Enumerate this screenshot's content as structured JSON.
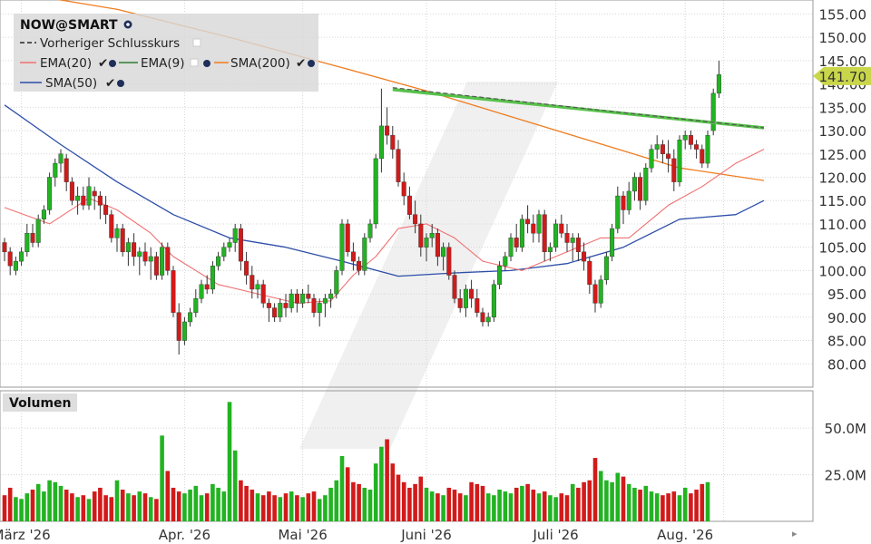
{
  "chart_data": {
    "type": "candlestick",
    "title": "NOW@SMART",
    "legend": {
      "placement": "top-left",
      "items": [
        {
          "label": "Vorheriger Schlusskurs",
          "color": "#555555",
          "style": "dashed"
        },
        {
          "label": "EMA(20)",
          "color": "#f07070"
        },
        {
          "label": "EMA(9)",
          "color": "#2e7d32"
        },
        {
          "label": "SMA(200)",
          "color": "#f07c1e"
        },
        {
          "label": "SMA(50)",
          "color": "#2d4ea8"
        }
      ]
    },
    "price_axis": {
      "ylim": [
        75,
        158
      ],
      "ticks": [
        80,
        85,
        90,
        95,
        100,
        105,
        110,
        115,
        120,
        125,
        130,
        135,
        140,
        145,
        150,
        155
      ],
      "tick_labels": [
        "80.00",
        "85.00",
        "90.00",
        "95.00",
        "100.00",
        "105.00",
        "110.00",
        "115.00",
        "120.00",
        "125.00",
        "130.00",
        "135.00",
        "140.00",
        "145.00",
        "150.00",
        "155.00"
      ],
      "last_price_label": "141.70",
      "last_price": 141.7
    },
    "volume_panel": {
      "title": "Volumen",
      "ylim": [
        0,
        70
      ],
      "ticks": [
        25,
        50
      ],
      "tick_labels": [
        "25.0M",
        "50.0M"
      ]
    },
    "date_labels": [
      "März '26",
      "Apr. '26",
      "Mai '26",
      "Juni '26",
      "Juli '26",
      "Aug. '26"
    ],
    "date_label_index": [
      3,
      32,
      53,
      75,
      98,
      121
    ],
    "candles": [
      [
        106,
        107,
        102,
        104
      ],
      [
        104,
        105,
        99,
        101
      ],
      [
        100,
        103,
        99,
        102
      ],
      [
        102,
        105,
        101,
        104
      ],
      [
        104,
        110,
        103,
        108
      ],
      [
        108,
        110,
        105,
        106
      ],
      [
        106,
        112,
        105,
        111
      ],
      [
        111,
        114,
        110,
        113
      ],
      [
        113,
        121,
        112,
        120
      ],
      [
        120,
        124,
        118,
        123
      ],
      [
        123,
        126,
        121,
        125
      ],
      [
        124,
        125,
        117,
        119
      ],
      [
        119,
        120,
        114,
        115
      ],
      [
        115,
        118,
        112,
        116
      ],
      [
        116,
        118,
        113,
        114
      ],
      [
        114,
        120,
        113,
        118
      ],
      [
        117,
        118,
        113,
        116
      ],
      [
        116,
        117,
        111,
        114
      ],
      [
        114,
        116,
        110,
        112
      ],
      [
        112,
        113,
        106,
        107
      ],
      [
        107,
        110,
        104,
        109
      ],
      [
        109,
        110,
        103,
        104
      ],
      [
        104,
        107,
        101,
        106
      ],
      [
        106,
        108,
        101,
        103
      ],
      [
        103,
        105,
        99,
        104
      ],
      [
        104,
        106,
        101,
        102
      ],
      [
        102,
        105,
        98,
        103
      ],
      [
        103,
        104,
        98,
        99
      ],
      [
        99,
        106,
        98,
        105
      ],
      [
        105,
        106,
        99,
        100
      ],
      [
        100,
        101,
        90,
        91
      ],
      [
        91,
        93,
        82,
        85
      ],
      [
        85,
        90,
        84,
        89
      ],
      [
        89,
        92,
        88,
        91
      ],
      [
        91,
        96,
        90,
        94
      ],
      [
        94,
        98,
        93,
        97
      ],
      [
        97,
        99,
        95,
        96
      ],
      [
        96,
        102,
        95,
        101
      ],
      [
        101,
        104,
        100,
        103
      ],
      [
        103,
        106,
        102,
        105
      ],
      [
        105,
        107,
        104,
        106
      ],
      [
        106,
        110,
        104,
        109
      ],
      [
        109,
        110,
        100,
        102
      ],
      [
        102,
        104,
        97,
        99
      ],
      [
        99,
        101,
        94,
        96
      ],
      [
        96,
        98,
        94,
        97
      ],
      [
        97,
        98,
        92,
        93
      ],
      [
        93,
        94,
        89,
        92
      ],
      [
        92,
        93,
        89,
        90
      ],
      [
        90,
        94,
        89,
        93
      ],
      [
        93,
        95,
        90,
        92
      ],
      [
        92,
        96,
        91,
        95
      ],
      [
        95,
        96,
        91,
        93
      ],
      [
        93,
        96,
        92,
        95
      ],
      [
        95,
        97,
        93,
        94
      ],
      [
        94,
        95,
        90,
        91
      ],
      [
        91,
        94,
        88,
        93
      ],
      [
        93,
        95,
        90,
        94
      ],
      [
        94,
        96,
        92,
        95
      ],
      [
        95,
        101,
        94,
        100
      ],
      [
        100,
        111,
        99,
        110
      ],
      [
        110,
        111,
        103,
        104
      ],
      [
        104,
        106,
        100,
        102
      ],
      [
        102,
        103,
        99,
        100
      ],
      [
        100,
        108,
        99,
        107
      ],
      [
        107,
        111,
        106,
        110
      ],
      [
        110,
        125,
        109,
        124
      ],
      [
        124,
        139,
        121,
        131
      ],
      [
        131,
        135,
        127,
        129
      ],
      [
        129,
        131,
        124,
        126
      ],
      [
        126,
        128,
        118,
        119
      ],
      [
        119,
        121,
        114,
        116
      ],
      [
        116,
        118,
        111,
        112
      ],
      [
        112,
        115,
        108,
        110
      ],
      [
        110,
        112,
        103,
        105
      ],
      [
        105,
        108,
        102,
        107
      ],
      [
        107,
        110,
        105,
        108
      ],
      [
        108,
        109,
        101,
        103
      ],
      [
        103,
        106,
        100,
        105
      ],
      [
        105,
        106,
        98,
        99
      ],
      [
        99,
        100,
        93,
        94
      ],
      [
        94,
        96,
        91,
        92
      ],
      [
        92,
        97,
        90,
        96
      ],
      [
        96,
        98,
        92,
        94
      ],
      [
        94,
        96,
        90,
        91
      ],
      [
        91,
        92,
        88,
        89
      ],
      [
        89,
        91,
        88,
        90
      ],
      [
        90,
        98,
        89,
        97
      ],
      [
        97,
        102,
        96,
        101
      ],
      [
        101,
        104,
        100,
        103
      ],
      [
        103,
        108,
        102,
        107
      ],
      [
        107,
        110,
        104,
        105
      ],
      [
        105,
        112,
        104,
        111
      ],
      [
        111,
        114,
        108,
        110
      ],
      [
        110,
        112,
        106,
        108
      ],
      [
        108,
        113,
        106,
        112
      ],
      [
        112,
        113,
        102,
        104
      ],
      [
        104,
        106,
        102,
        105
      ],
      [
        105,
        111,
        104,
        110
      ],
      [
        110,
        112,
        107,
        108
      ],
      [
        108,
        110,
        104,
        106
      ],
      [
        106,
        108,
        102,
        107
      ],
      [
        107,
        108,
        102,
        104
      ],
      [
        104,
        106,
        100,
        102
      ],
      [
        102,
        103,
        95,
        97
      ],
      [
        97,
        98,
        91,
        93
      ],
      [
        93,
        99,
        92,
        98
      ],
      [
        98,
        104,
        97,
        103
      ],
      [
        103,
        110,
        102,
        109
      ],
      [
        109,
        118,
        108,
        116
      ],
      [
        116,
        117,
        110,
        113
      ],
      [
        113,
        119,
        112,
        117
      ],
      [
        117,
        121,
        115,
        120
      ],
      [
        120,
        121,
        113,
        115
      ],
      [
        115,
        123,
        114,
        122
      ],
      [
        122,
        127,
        121,
        126
      ],
      [
        126,
        129,
        124,
        127
      ],
      [
        127,
        128,
        123,
        125
      ],
      [
        125,
        128,
        121,
        124
      ],
      [
        124,
        126,
        117,
        119
      ],
      [
        119,
        129,
        118,
        128
      ],
      [
        128,
        130,
        126,
        129
      ],
      [
        129,
        130,
        126,
        127
      ],
      [
        127,
        128,
        124,
        126
      ],
      [
        126,
        127,
        122,
        123
      ],
      [
        123,
        130,
        122,
        129
      ],
      [
        130,
        139,
        129,
        138
      ],
      [
        138,
        145,
        137,
        142
      ]
    ],
    "volumes": [
      14,
      18,
      13,
      12,
      15,
      17,
      20,
      16,
      22,
      21,
      19,
      17,
      15,
      13,
      14,
      12,
      16,
      18,
      14,
      13,
      22,
      17,
      15,
      14,
      16,
      15,
      13,
      12,
      46,
      27,
      18,
      16,
      15,
      17,
      19,
      14,
      15,
      20,
      18,
      16,
      64,
      38,
      22,
      19,
      17,
      15,
      14,
      16,
      14,
      13,
      15,
      16,
      14,
      13,
      15,
      16,
      12,
      14,
      18,
      22,
      35,
      29,
      21,
      20,
      18,
      17,
      31,
      40,
      44,
      31,
      25,
      21,
      18,
      20,
      24,
      18,
      16,
      15,
      14,
      18,
      17,
      15,
      14,
      21,
      20,
      19,
      15,
      14,
      17,
      16,
      15,
      18,
      19,
      20,
      17,
      15,
      16,
      14,
      13,
      15,
      14,
      20,
      18,
      21,
      22,
      34,
      27,
      22,
      21,
      26,
      24,
      20,
      18,
      17,
      19,
      16,
      15,
      14,
      15,
      16,
      14,
      18,
      15,
      17,
      20,
      21
    ],
    "ema20": [
      [
        0,
        113.5
      ],
      [
        8,
        110
      ],
      [
        15,
        115.5
      ],
      [
        20,
        113
      ],
      [
        26,
        108
      ],
      [
        30,
        103
      ],
      [
        38,
        97
      ],
      [
        45,
        95
      ],
      [
        52,
        93
      ],
      [
        58,
        93.5
      ],
      [
        62,
        99
      ],
      [
        66,
        103
      ],
      [
        70,
        109
      ],
      [
        75,
        110
      ],
      [
        80,
        107
      ],
      [
        85,
        102
      ],
      [
        92,
        100
      ],
      [
        100,
        104
      ],
      [
        106,
        107
      ],
      [
        111,
        107
      ],
      [
        118,
        114
      ],
      [
        124,
        118
      ],
      [
        130,
        123
      ],
      [
        135,
        126
      ]
    ],
    "ema9": [
      [
        69,
        138.8
      ],
      [
        135,
        130.6
      ]
    ],
    "sma200": [
      [
        0,
        160
      ],
      [
        20,
        156
      ],
      [
        40,
        150
      ],
      [
        60,
        143.5
      ],
      [
        75,
        138.5
      ],
      [
        90,
        133
      ],
      [
        105,
        127.5
      ],
      [
        120,
        122
      ],
      [
        135,
        119.3
      ]
    ],
    "sma50": [
      [
        0,
        135.5
      ],
      [
        10,
        127
      ],
      [
        20,
        119
      ],
      [
        30,
        112
      ],
      [
        40,
        107
      ],
      [
        50,
        105
      ],
      [
        60,
        102
      ],
      [
        70,
        98.8
      ],
      [
        80,
        99.5
      ],
      [
        90,
        100
      ],
      [
        100,
        101.5
      ],
      [
        110,
        105
      ],
      [
        120,
        111
      ],
      [
        130,
        112
      ],
      [
        135,
        115
      ]
    ],
    "prev_close_line": [
      [
        69,
        139.2
      ],
      [
        135,
        130.6
      ]
    ]
  }
}
